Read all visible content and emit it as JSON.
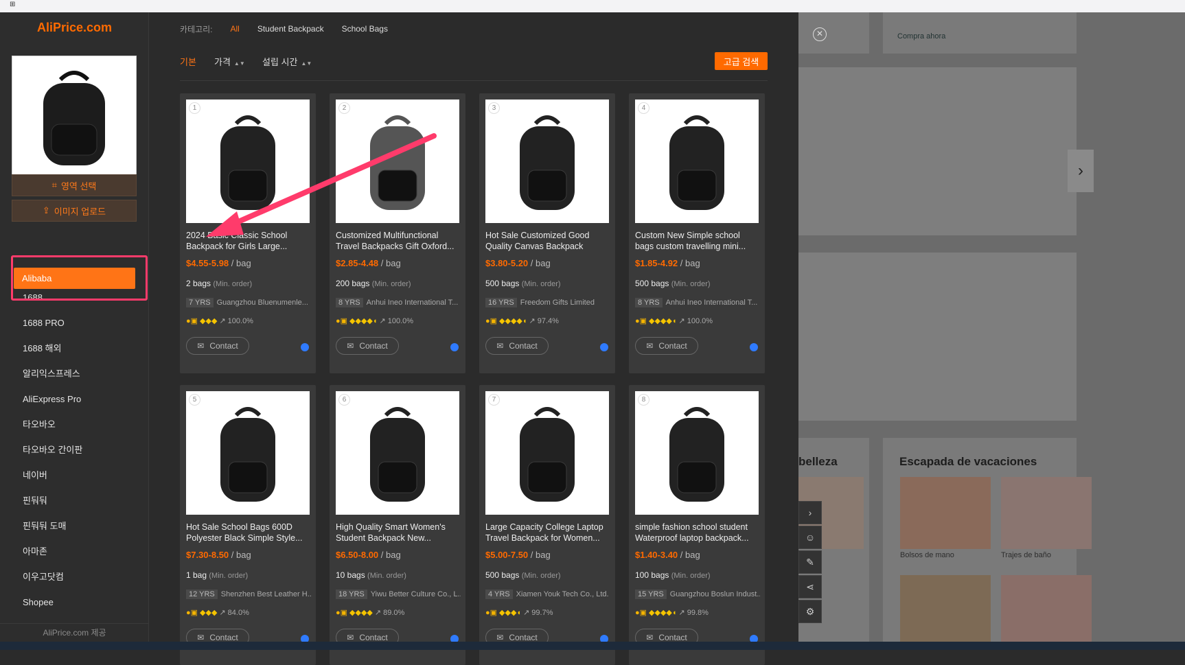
{
  "app": {
    "logo": "AliPrice.com",
    "footer": "AliPrice.com 제공"
  },
  "sidebar": {
    "region_select": "영역 선택",
    "image_upload": "이미지 업로드",
    "sources": [
      "Alibaba",
      "1688",
      "1688 PRO",
      "1688 해외",
      "알리익스프레스",
      "AliExpress Pro",
      "타오바오",
      "타오바오 간이판",
      "네이버",
      "핀둬둬",
      "핀둬둬 도매",
      "아마존",
      "이우고닷컴",
      "Shopee"
    ]
  },
  "categories": {
    "label": "카테고리:",
    "items": [
      "All",
      "Student Backpack",
      "School Bags"
    ]
  },
  "sort": {
    "items": [
      "기본",
      "가격",
      "설립 시간"
    ],
    "advanced": "고급 검색"
  },
  "products": [
    {
      "n": "1",
      "title": "2024 Basic Classic School Backpack for Girls Large...",
      "price": "$4.55-5.98",
      "unit": "/ bag",
      "moq": "2 bags",
      "moq_note": "(Min. order)",
      "yrs": "7",
      "supplier": "Guangzhou Bluenumenle...",
      "diamonds": "3",
      "rate": "100.0%",
      "contact": "Contact",
      "shade": "#222"
    },
    {
      "n": "2",
      "title": "Customized Multifunctional Travel Backpacks Gift Oxford...",
      "price": "$2.85-4.48",
      "unit": "/ bag",
      "moq": "200 bags",
      "moq_note": "(Min. order)",
      "yrs": "8",
      "supplier": "Anhui Ineo International T...",
      "diamonds": "4.5",
      "rate": "100.0%",
      "contact": "Contact",
      "shade": "#555"
    },
    {
      "n": "3",
      "title": "Hot Sale Customized Good Quality Canvas Backpack",
      "price": "$3.80-5.20",
      "unit": "/ bag",
      "moq": "500 bags",
      "moq_note": "(Min. order)",
      "yrs": "16",
      "supplier": "Freedom Gifts Limited",
      "diamonds": "4.5",
      "rate": "97.4%",
      "contact": "Contact",
      "shade": "#222"
    },
    {
      "n": "4",
      "title": "Custom New Simple school bags custom travelling mini...",
      "price": "$1.85-4.92",
      "unit": "/ bag",
      "moq": "500 bags",
      "moq_note": "(Min. order)",
      "yrs": "8",
      "supplier": "Anhui Ineo International T...",
      "diamonds": "4.5",
      "rate": "100.0%",
      "contact": "Contact",
      "shade": "#222"
    },
    {
      "n": "5",
      "title": "Hot Sale School Bags 600D Polyester Black Simple Style...",
      "price": "$7.30-8.50",
      "unit": "/ bag",
      "moq": "1 bag",
      "moq_note": "(Min. order)",
      "yrs": "12",
      "supplier": "Shenzhen Best Leather H...",
      "diamonds": "3",
      "rate": "84.0%",
      "contact": "Contact",
      "shade": "#222"
    },
    {
      "n": "6",
      "title": "High Quality Smart Women's Student Backpack New...",
      "price": "$6.50-8.00",
      "unit": "/ bag",
      "moq": "10 bags",
      "moq_note": "(Min. order)",
      "yrs": "18",
      "supplier": "Yiwu Better Culture Co., L...",
      "diamonds": "4",
      "rate": "89.0%",
      "contact": "Contact",
      "shade": "#222"
    },
    {
      "n": "7",
      "title": "Large Capacity College Laptop Travel Backpack for Women...",
      "price": "$5.00-7.50",
      "unit": "/ bag",
      "moq": "500 bags",
      "moq_note": "(Min. order)",
      "yrs": "4",
      "supplier": "Xiamen Youk Tech Co., Ltd.",
      "diamonds": "3.5",
      "rate": "99.7%",
      "contact": "Contact",
      "shade": "#222"
    },
    {
      "n": "8",
      "title": "simple fashion school student Waterproof laptop backpack...",
      "price": "$1.40-3.40",
      "unit": "/ bag",
      "moq": "100 bags",
      "moq_note": "(Min. order)",
      "yrs": "15",
      "supplier": "Guangzhou Boslun Indust...",
      "diamonds": "4.5",
      "rate": "99.8%",
      "contact": "Contact",
      "shade": "#222"
    }
  ],
  "yrs_label": "YRS",
  "background": {
    "compra": "Compra ahora",
    "belleza": "belleza",
    "vacaciones": "Escapada de vacaciones",
    "bolsos": "Bolsos de mano",
    "trajes": "Trajes de baño"
  }
}
